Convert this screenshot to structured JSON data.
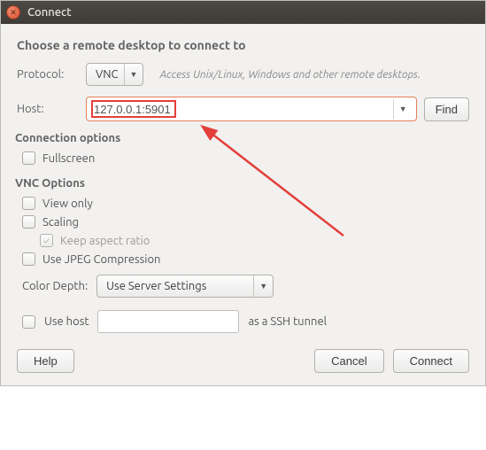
{
  "titlebar": {
    "title": "Connect"
  },
  "heading": "Choose a remote desktop to connect to",
  "protocol": {
    "label": "Protocol:",
    "value": "VNC",
    "hint": "Access Unix/Linux, Windows and other remote desktops."
  },
  "host": {
    "label": "Host:",
    "value": "127.0.0.1:5901",
    "find": "Find"
  },
  "conn_options": {
    "title": "Connection options",
    "fullscreen": "Fullscreen"
  },
  "vnc_options": {
    "title": "VNC Options",
    "view_only": "View only",
    "scaling": "Scaling",
    "keep_aspect": "Keep aspect ratio",
    "jpeg": "Use JPEG Compression",
    "color_depth_label": "Color Depth:",
    "color_depth_value": "Use Server Settings",
    "use_host": "Use host",
    "ssh_suffix": "as a SSH tunnel"
  },
  "footer": {
    "help": "Help",
    "cancel": "Cancel",
    "connect": "Connect"
  }
}
